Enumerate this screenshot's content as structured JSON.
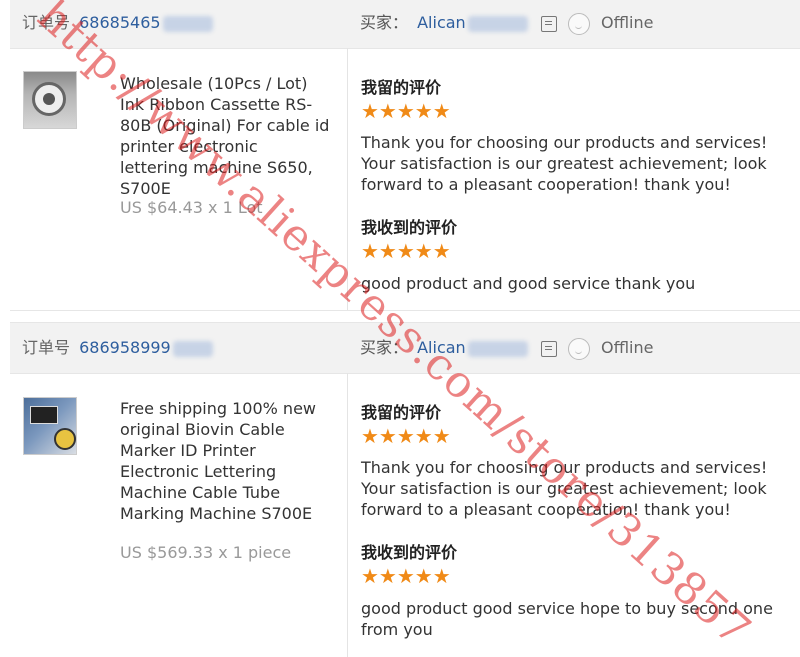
{
  "orders": [
    {
      "order_label": "订单号",
      "order_number": "68685465",
      "buyer_label": "买家：",
      "buyer_name": "Alican",
      "status": "Offline",
      "product_title": "Wholesale (10Pcs / Lot) Ink Ribbon Cassette RS-80B (Original) For cable id printer electronic lettering machine S650, S700E",
      "price": "US $64.43 x 1 Lot",
      "my_review_label": "我留的评价",
      "my_review_stars": "★★★★★",
      "my_review_rating": 5,
      "my_review_text": "Thank you for choosing our products and services! Your satisfaction is our greatest achievement; look forward to a pleasant cooperation! thank you!",
      "received_review_label": "我收到的评价",
      "received_review_stars": "★★★★★",
      "received_review_rating": 5,
      "received_review_text": "good product and good service thank you"
    },
    {
      "order_label": "订单号",
      "order_number": "686958999",
      "buyer_label": "买家：",
      "buyer_name": "Alican",
      "status": "Offline",
      "product_title": "Free shipping 100% new original Biovin Cable Marker ID Printer Electronic Lettering Machine Cable Tube Marking Machine S700E",
      "price": "US $569.33 x 1 piece",
      "my_review_label": "我留的评价",
      "my_review_stars": "★★★★★",
      "my_review_rating": 5,
      "my_review_text": "Thank you for choosing our products and services! Your satisfaction is our greatest achievement; look forward to a pleasant cooperation! thank you!",
      "received_review_label": "我收到的评价",
      "received_review_stars": "★★★★★",
      "received_review_rating": 5,
      "received_review_text": "good product good service hope to buy second one from you"
    }
  ],
  "watermark": "http://www.aliexpress.com/store/313857",
  "colors": {
    "link": "#2e5e9e",
    "star": "#f08a17",
    "header_bg": "#f2f2f2",
    "watermark": "#dc1e1e"
  }
}
